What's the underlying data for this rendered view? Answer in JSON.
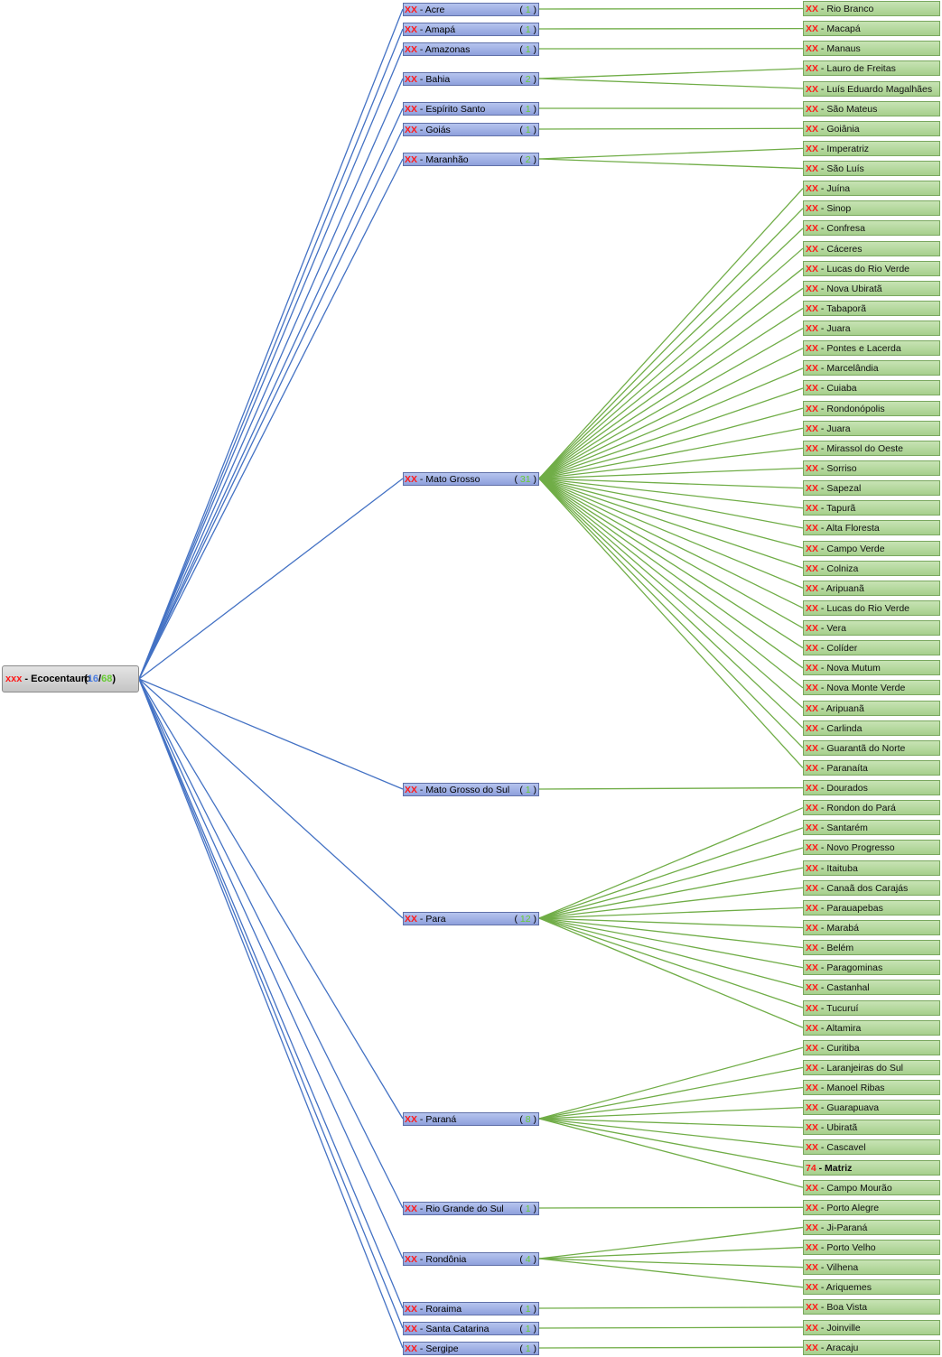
{
  "colors": {
    "state_edge": "#4472c4",
    "city_edge": "#70ad47",
    "code": "#ff1a1a",
    "count_blue": "#4f7fe0",
    "count_green": "#66cc33"
  },
  "root": {
    "code": "xxx",
    "sep": " - ",
    "label": "Ecocentauro",
    "count_open": "(",
    "count_blue": "16",
    "count_slash": "/",
    "count_green": "68",
    "count_close": ")"
  },
  "states": [
    {
      "code": "XX",
      "label": "Acre",
      "count": "1",
      "cities": [
        {
          "code": "XX",
          "label": "Rio Branco"
        }
      ]
    },
    {
      "code": "XX",
      "label": "Amapá",
      "count": "1",
      "cities": [
        {
          "code": "XX",
          "label": "Macapá"
        }
      ]
    },
    {
      "code": "XX",
      "label": "Amazonas",
      "count": "1",
      "cities": [
        {
          "code": "XX",
          "label": "Manaus"
        }
      ]
    },
    {
      "code": "XX",
      "label": "Bahia",
      "count": "2",
      "cities": [
        {
          "code": "XX",
          "label": "Lauro de Freitas"
        },
        {
          "code": "XX",
          "label": "Luís Eduardo Magalhães"
        }
      ]
    },
    {
      "code": "XX",
      "label": "Espírito Santo",
      "count": "1",
      "cities": [
        {
          "code": "XX",
          "label": "São Mateus"
        }
      ]
    },
    {
      "code": "XX",
      "label": "Goiás",
      "count": "1",
      "cities": [
        {
          "code": "XX",
          "label": "Goiânia"
        }
      ]
    },
    {
      "code": "XX",
      "label": "Maranhão",
      "count": "2",
      "cities": [
        {
          "code": "XX",
          "label": "Imperatriz"
        },
        {
          "code": "XX",
          "label": "São Luís"
        }
      ]
    },
    {
      "code": "XX",
      "label": "Mato  Grosso",
      "count": "31",
      "cities": [
        {
          "code": "XX",
          "label": "Juína"
        },
        {
          "code": "XX",
          "label": "Sinop"
        },
        {
          "code": "XX",
          "label": "Confresa"
        },
        {
          "code": "XX",
          "label": "Cáceres"
        },
        {
          "code": "XX",
          "label": "Lucas do Rio Verde"
        },
        {
          "code": "XX",
          "label": "Nova  Ubiratã"
        },
        {
          "code": "XX",
          "label": "Tabaporã"
        },
        {
          "code": "XX",
          "label": "Juara"
        },
        {
          "code": "XX",
          "label": "Pontes  e Lacerda"
        },
        {
          "code": "XX",
          "label": "Marcelândia"
        },
        {
          "code": "XX",
          "label": "Cuiaba"
        },
        {
          "code": "XX",
          "label": "Rondonópolis"
        },
        {
          "code": "XX",
          "label": "Juara"
        },
        {
          "code": "XX",
          "label": "Mirassol do Oeste"
        },
        {
          "code": "XX",
          "label": "Sorriso"
        },
        {
          "code": "XX",
          "label": "Sapezal"
        },
        {
          "code": "XX",
          "label": "Tapurã"
        },
        {
          "code": "XX",
          "label": "Alta Floresta"
        },
        {
          "code": "XX",
          "label": "Campo  Verde"
        },
        {
          "code": "XX",
          "label": "Colniza"
        },
        {
          "code": "XX",
          "label": "Aripuanã"
        },
        {
          "code": "XX",
          "label": "Lucas do Rio Verde"
        },
        {
          "code": "XX",
          "label": "Vera"
        },
        {
          "code": "XX",
          "label": "Colíder"
        },
        {
          "code": "XX",
          "label": "Nova  Mutum"
        },
        {
          "code": "XX",
          "label": "Nova  Monte  Verde"
        },
        {
          "code": "XX",
          "label": "Aripuanã"
        },
        {
          "code": "XX",
          "label": "Carlinda"
        },
        {
          "code": "XX",
          "label": "Guarantã  do Norte"
        },
        {
          "code": "XX",
          "label": "Paranaíta"
        }
      ]
    },
    {
      "code": "XX",
      "label": "Mato  Grosso do Sul",
      "count": "1",
      "cities": [
        {
          "code": "XX",
          "label": "Dourados"
        }
      ]
    },
    {
      "code": "XX",
      "label": "Para",
      "count": "12",
      "cities": [
        {
          "code": "XX",
          "label": "Rondon  do Pará"
        },
        {
          "code": "XX",
          "label": "Santarém"
        },
        {
          "code": "XX",
          "label": "Novo  Progresso"
        },
        {
          "code": "XX",
          "label": "Itaituba"
        },
        {
          "code": "XX",
          "label": "Canaã dos Carajás"
        },
        {
          "code": "XX",
          "label": "Parauapebas"
        },
        {
          "code": "XX",
          "label": "Marabá"
        },
        {
          "code": "XX",
          "label": "Belém"
        },
        {
          "code": "XX",
          "label": "Paragominas"
        },
        {
          "code": "XX",
          "label": "Castanhal"
        },
        {
          "code": "XX",
          "label": "Tucuruí"
        },
        {
          "code": "XX",
          "label": "Altamira"
        }
      ]
    },
    {
      "code": "XX",
      "label": "Paraná",
      "count": "8",
      "cities": [
        {
          "code": "XX",
          "label": "Curitiba"
        },
        {
          "code": "XX",
          "label": "Laranjeiras do Sul"
        },
        {
          "code": "XX",
          "label": "Manoel Ribas"
        },
        {
          "code": "XX",
          "label": "Guarapuava"
        },
        {
          "code": "XX",
          "label": "Ubiratã"
        },
        {
          "code": "XX",
          "label": "Cascavel"
        },
        {
          "code": "74",
          "label": "Matriz",
          "bold": true
        },
        {
          "code": "XX",
          "label": "Campo  Mourão"
        }
      ]
    },
    {
      "code": "XX",
      "label": "Rio  Grande do Sul",
      "count": "1",
      "cities": [
        {
          "code": "XX",
          "label": "Porto  Alegre"
        }
      ]
    },
    {
      "code": "XX",
      "label": "Rondônia",
      "count": "4",
      "cities": [
        {
          "code": "XX",
          "label": "Ji-Paraná"
        },
        {
          "code": "XX",
          "label": "Porto  Velho"
        },
        {
          "code": "XX",
          "label": "Vilhena"
        },
        {
          "code": "XX",
          "label": "Ariquemes"
        }
      ]
    },
    {
      "code": "XX",
      "label": "Roraima",
      "count": "1",
      "cities": [
        {
          "code": "XX",
          "label": "Boa Vista"
        }
      ]
    },
    {
      "code": "XX",
      "label": "Santa  Catarina",
      "count": "1",
      "cities": [
        {
          "code": "XX",
          "label": "Joinville"
        }
      ]
    },
    {
      "code": "XX",
      "label": "Sergipe",
      "count": "1",
      "cities": [
        {
          "code": "XX",
          "label": "Aracaju"
        }
      ]
    }
  ]
}
